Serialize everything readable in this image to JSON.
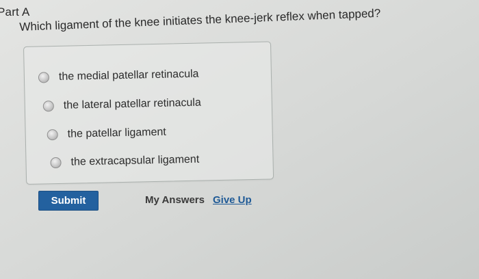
{
  "part": {
    "title": "Part A"
  },
  "question": {
    "text": "Which ligament of the knee initiates the knee-jerk reflex when tapped?"
  },
  "options": [
    {
      "label": "the medial patellar retinacula",
      "selected": false
    },
    {
      "label": "the lateral patellar retinacula",
      "selected": false
    },
    {
      "label": "the patellar ligament",
      "selected": false
    },
    {
      "label": "the extracapsular ligament",
      "selected": false
    }
  ],
  "actions": {
    "submit_label": "Submit",
    "my_answers_label": "My Answers",
    "give_up_label": "Give Up"
  },
  "colors": {
    "submit_bg": "#23619f",
    "link": "#1f5a96"
  }
}
